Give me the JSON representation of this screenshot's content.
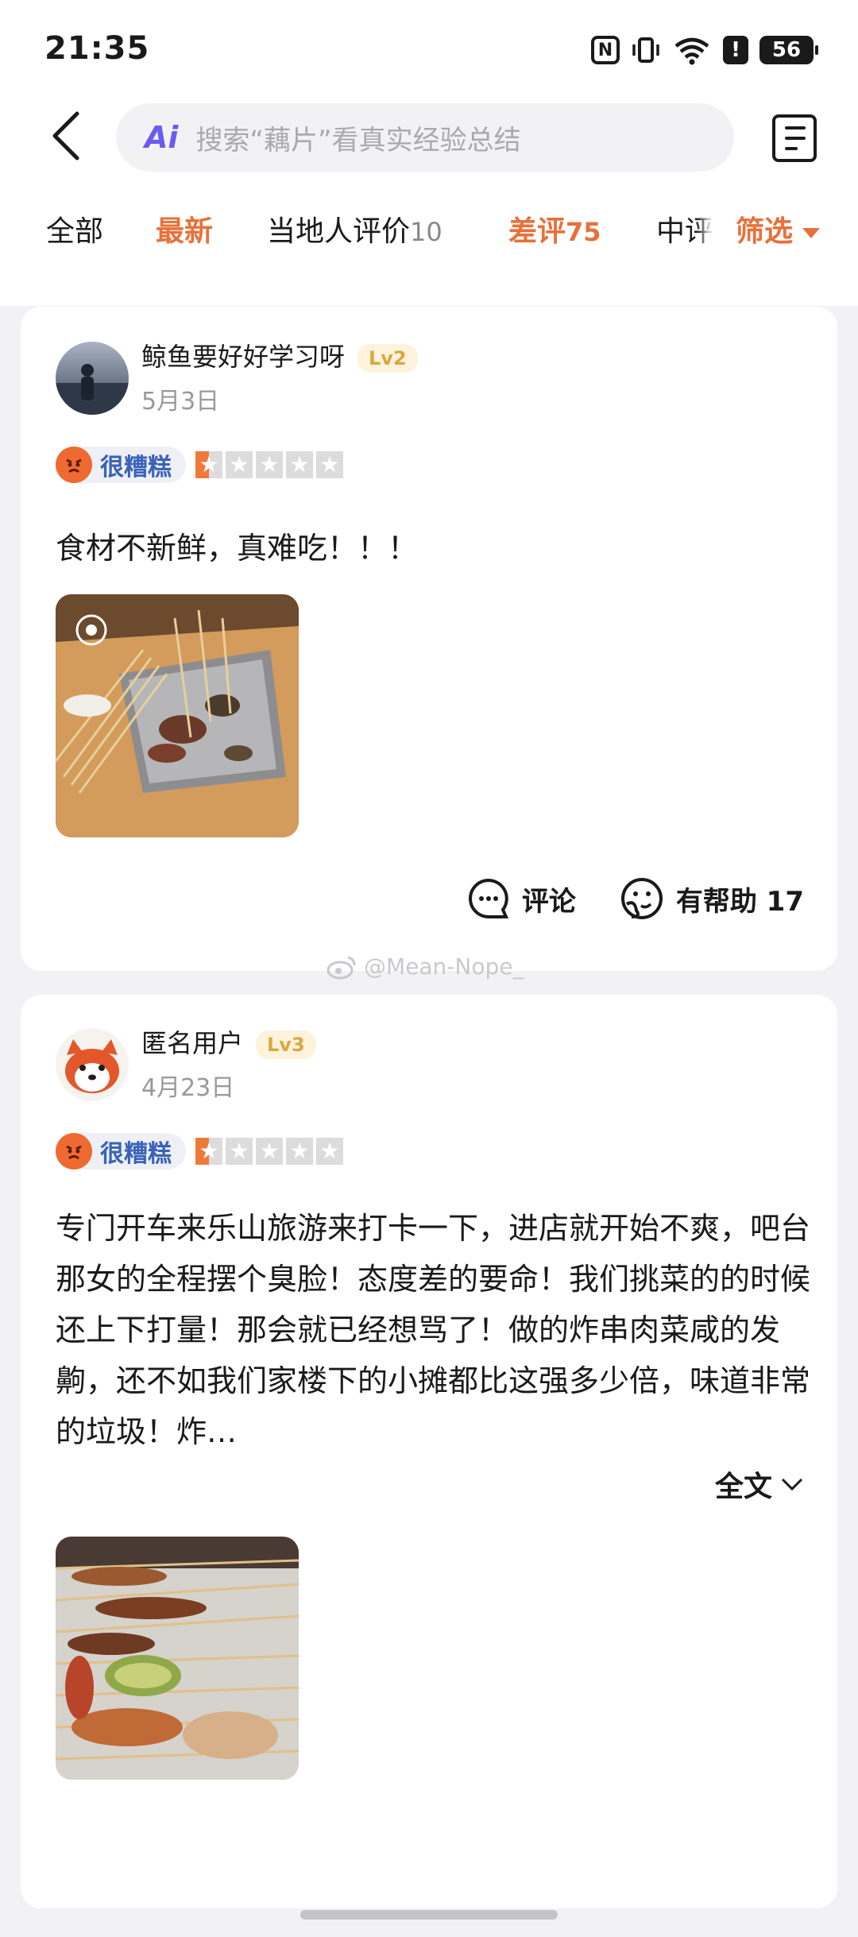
{
  "status_bar": {
    "time": "21:35",
    "battery": "56",
    "icons": [
      "nfc-icon",
      "vibrate-icon",
      "wifi-icon",
      "alert-icon",
      "battery-icon"
    ]
  },
  "header": {
    "search_placeholder": "搜索“藕片”看真实经验总结",
    "ai_label": "Ai",
    "icons": [
      "back-arrow-icon",
      "ai-icon",
      "menu-document-icon"
    ]
  },
  "tabs": [
    {
      "label": "全部",
      "count": ""
    },
    {
      "label": "最新",
      "count": ""
    },
    {
      "label": "当地人评价",
      "count": "10"
    },
    {
      "label": "差评",
      "count": "75"
    },
    {
      "label": "中评",
      "count": ""
    }
  ],
  "filter_label": "筛选",
  "colors": {
    "accent": "#e8703a",
    "rating_blue": "#3a62b8",
    "level_gold": "#d9a93e"
  },
  "reviews": [
    {
      "username": "鲸鱼要好好学习呀",
      "level": "Lv2",
      "date": "5月3日",
      "rating_label": "很糟糕",
      "stars": 0.5,
      "text": "食材不新鲜，真难吃！！！",
      "comment_label": "评论",
      "helpful_label": "有帮助 17"
    },
    {
      "username": "匿名用户",
      "level": "Lv3",
      "date": "4月23日",
      "rating_label": "很糟糕",
      "stars": 0.5,
      "text": "专门开车来乐山旅游来打卡一下，进店就开始不爽，吧台那女的全程摆个臭脸！态度差的要命！我们挑菜的的时候还上下打量！那会就已经想骂了！做的炸串肉菜咸的发齁，还不如我们家楼下的小摊都比这强多少倍，味道非常的垃圾！炸…",
      "fulltext_label": "全文"
    }
  ],
  "watermark": "@Mean-Nope_"
}
